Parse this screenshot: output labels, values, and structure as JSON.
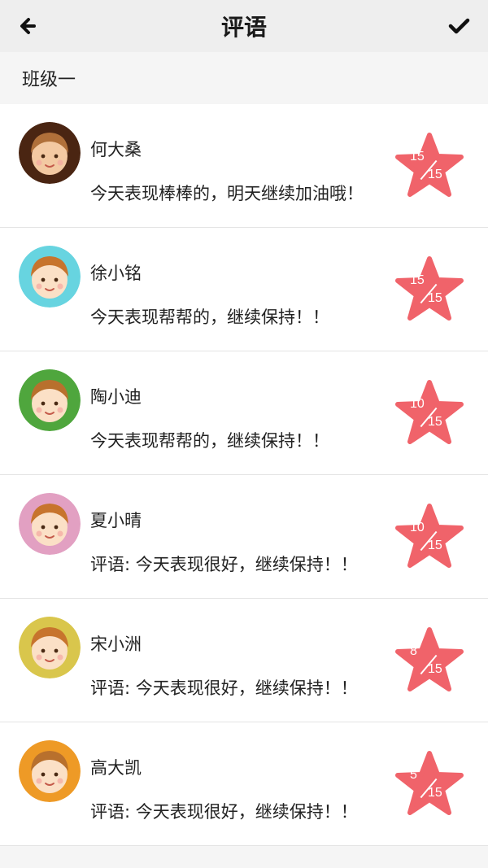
{
  "header": {
    "title": "评语"
  },
  "class_name": "班级一",
  "students": [
    {
      "name": "何大桑",
      "comment": "今天表现棒棒的，明天继续加油哦！",
      "score": "15",
      "total": "15",
      "avatar_bg": "#4a2512",
      "face": "#f3c9a2",
      "hair": "#b0703a"
    },
    {
      "name": "徐小铭",
      "comment": "今天表现帮帮的，继续保持！！",
      "score": "15",
      "total": "15",
      "avatar_bg": "#67d4e0",
      "face": "#fbe0c6",
      "hair": "#c7742d"
    },
    {
      "name": "陶小迪",
      "comment": "今天表现帮帮的，继续保持！！",
      "score": "10",
      "total": "15",
      "avatar_bg": "#4fa63d",
      "face": "#fbe0c6",
      "hair": "#b8702d"
    },
    {
      "name": "夏小晴",
      "comment": "评语: 今天表现很好，继续保持！！",
      "score": "10",
      "total": "15",
      "avatar_bg": "#e2a0c2",
      "face": "#fbe0c6",
      "hair": "#c7742d"
    },
    {
      "name": "宋小洲",
      "comment": "评语: 今天表现很好，继续保持！！",
      "score": "8",
      "total": "15",
      "avatar_bg": "#d9c64c",
      "face": "#fbe0c6",
      "hair": "#c7742d"
    },
    {
      "name": "高大凯",
      "comment": "评语: 今天表现很好，继续保持！！",
      "score": "5",
      "total": "15",
      "avatar_bg": "#ee9a26",
      "face": "#fbe0c6",
      "hair": "#b8702d"
    }
  ],
  "colors": {
    "star": "#f0636a",
    "header_bg": "#eeeeee"
  },
  "icons": {
    "back": "arrow-left-icon",
    "confirm": "checkmark-icon",
    "score": "star-icon"
  }
}
